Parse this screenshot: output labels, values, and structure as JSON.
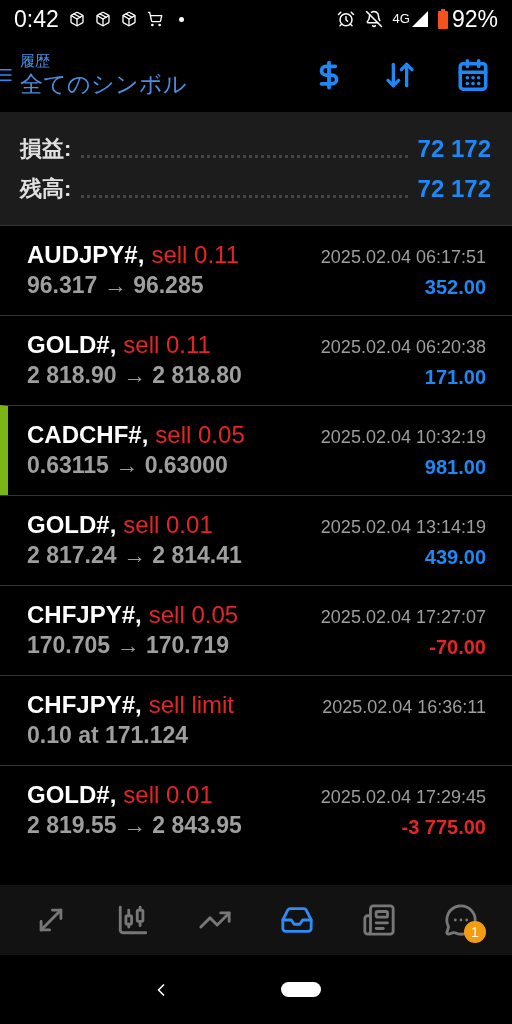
{
  "status_bar": {
    "time": "0:42",
    "network": "4G",
    "battery": "92%"
  },
  "header": {
    "subtitle": "履歴",
    "title": "全てのシンボル"
  },
  "summary": [
    {
      "label": "損益:",
      "value": "72 172"
    },
    {
      "label": "残高:",
      "value": "72 172"
    }
  ],
  "deals": [
    {
      "symbol": "AUDJPY#,",
      "side": "sell 0.11",
      "prices": "96.317 → 96.285",
      "time": "2025.02.04 06:17:51",
      "profit": "352.00",
      "loss": false,
      "marked": false
    },
    {
      "symbol": "GOLD#,",
      "side": "sell 0.11",
      "prices": "2 818.90 → 2 818.80",
      "time": "2025.02.04 06:20:38",
      "profit": "171.00",
      "loss": false,
      "marked": false
    },
    {
      "symbol": "CADCHF#,",
      "side": "sell 0.05",
      "prices": "0.63115 → 0.63000",
      "time": "2025.02.04 10:32:19",
      "profit": "981.00",
      "loss": false,
      "marked": true
    },
    {
      "symbol": "GOLD#,",
      "side": "sell 0.01",
      "prices": "2 817.24 → 2 814.41",
      "time": "2025.02.04 13:14:19",
      "profit": "439.00",
      "loss": false,
      "marked": false
    },
    {
      "symbol": "CHFJPY#,",
      "side": "sell 0.05",
      "prices": "170.705 → 170.719",
      "time": "2025.02.04 17:27:07",
      "profit": "-70.00",
      "loss": true,
      "marked": false
    },
    {
      "symbol": "CHFJPY#,",
      "side": "sell limit",
      "prices": "0.10 at 171.124",
      "time": "2025.02.04 16:36:11",
      "marked": false
    },
    {
      "symbol": "GOLD#,",
      "side": "sell 0.01",
      "prices": "2 819.55 → 2 843.95",
      "time": "2025.02.04 17:29:45",
      "profit": "-3 775.00",
      "loss": true,
      "marked": false
    }
  ],
  "bottom_nav": [
    {
      "kind": "quotes",
      "selected": false
    },
    {
      "kind": "chart",
      "selected": false
    },
    {
      "kind": "trade",
      "selected": false
    },
    {
      "kind": "history",
      "selected": true
    },
    {
      "kind": "news",
      "selected": false
    },
    {
      "kind": "messages",
      "selected": false,
      "badge": "1"
    }
  ]
}
